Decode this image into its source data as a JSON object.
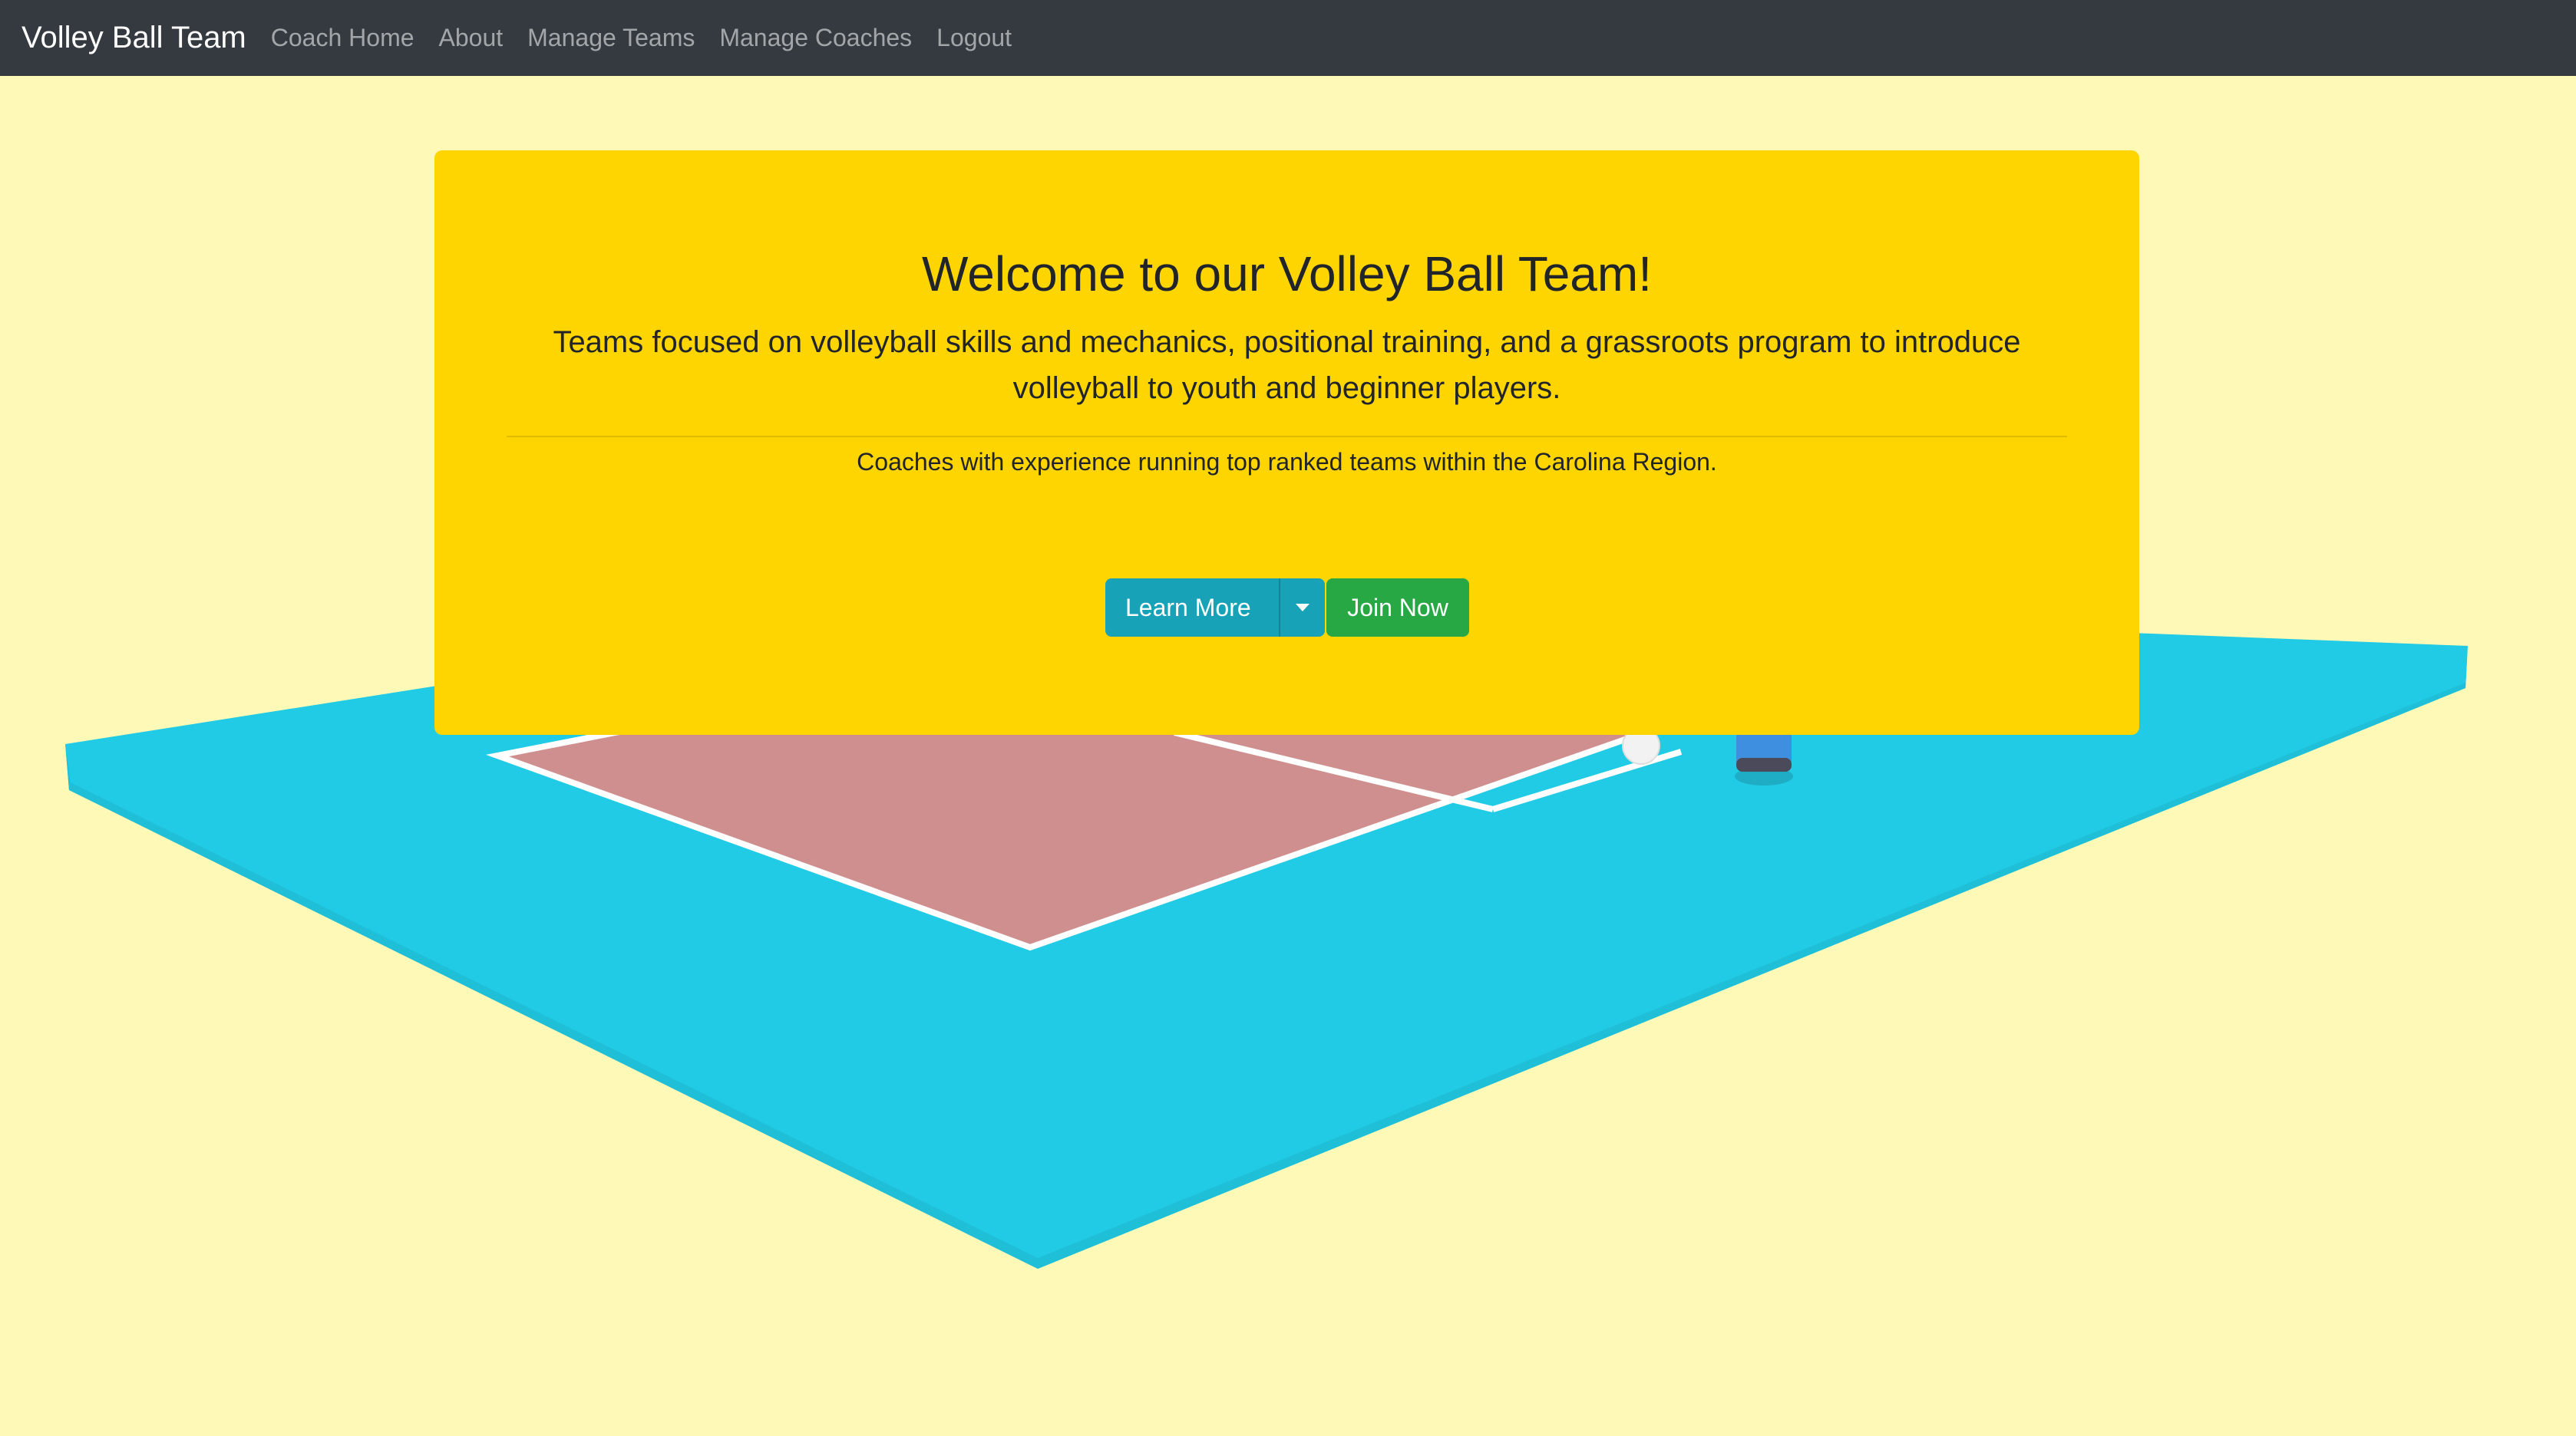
{
  "navbar": {
    "brand": "Volley Ball Team",
    "links": [
      "Coach Home",
      "About",
      "Manage Teams",
      "Manage Coaches",
      "Logout"
    ]
  },
  "jumbotron": {
    "title": "Welcome to our Volley Ball Team!",
    "lead": "Teams focused on volleyball skills and mechanics, positional training, and a grassroots program to introduce volleyball to youth and beginner players.",
    "sub": "Coaches with experience running top ranked teams within the Carolina Region.",
    "learn_more": "Learn More",
    "join_now": "Join Now"
  },
  "colors": {
    "background": "#fff9b8",
    "navbar": "#343a40",
    "card": "#ffd500",
    "floor": "#21cbe5",
    "court": "#d08f8f",
    "learn_button": "#17a2b8",
    "join_button": "#28a745"
  }
}
